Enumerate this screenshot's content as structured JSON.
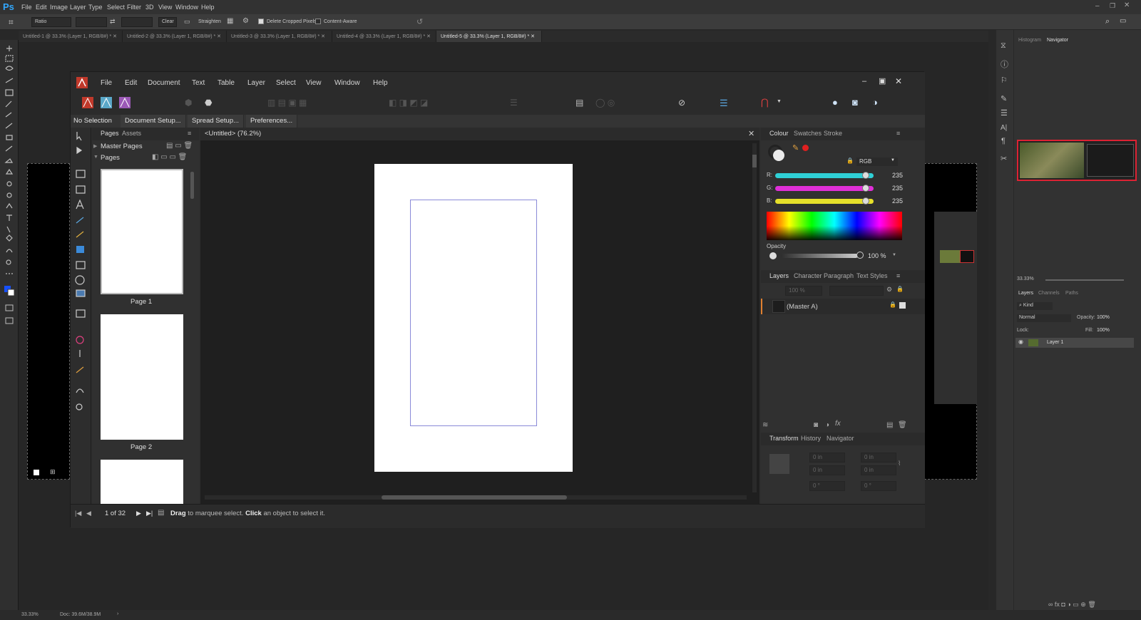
{
  "ps": {
    "logo": "Ps",
    "menu": [
      "File",
      "Edit",
      "Image",
      "Layer",
      "Type",
      "Select",
      "Filter",
      "3D",
      "View",
      "Window",
      "Help"
    ],
    "options": {
      "ratio": "Ratio",
      "clear": "Clear",
      "straighten": "Straighten",
      "delete_cropped": "Delete Cropped Pixels",
      "content_aware": "Content-Aware"
    },
    "tabs": [
      "Untitled-1 @ 33.3% (Layer 1, RGB/8#) *",
      "Untitled-2 @ 33.3% (Layer 1, RGB/8#) *",
      "Untitled-3 @ 33.3% (Layer 1, RGB/8#) *",
      "Untitled-4 @ 33.3% (Layer 1, RGB/8#) *",
      "Untitled-5 @ 33.3% (Layer 1, RGB/8#) *"
    ],
    "status_zoom": "33.33%",
    "status_doc": "Doc: 39.6M/38.9M",
    "panel": {
      "top_tabs": [
        "Histogram",
        "Navigator"
      ],
      "nav_zoom": "33.33%",
      "layer_tabs": [
        "Layers",
        "Channels",
        "Paths"
      ],
      "kind": "Kind",
      "blend": "Normal",
      "opacity_label": "Opacity:",
      "opacity_val": "100%",
      "lock_label": "Lock:",
      "fill_label": "Fill:",
      "fill_val": "100%",
      "layer_name": "Layer 1"
    }
  },
  "af": {
    "menu": [
      "File",
      "Edit",
      "Document",
      "Text",
      "Table",
      "Layer",
      "Select",
      "View",
      "Window",
      "Help"
    ],
    "context": {
      "selection": "No Selection",
      "buttons": [
        "Document Setup...",
        "Spread Setup...",
        "Preferences..."
      ]
    },
    "pages_panel": {
      "tabs": [
        "Pages",
        "Assets"
      ],
      "master_pages": "Master Pages",
      "pages": "Pages",
      "thumbs": [
        "Page 1",
        "Page 2"
      ]
    },
    "doc_tab": "<Untitled> (76.2%)",
    "colour": {
      "tabs": [
        "Colour",
        "Swatches",
        "Stroke"
      ],
      "model": "RGB",
      "channels": [
        {
          "label": "R:",
          "value": "235",
          "color": "#2fd0d6"
        },
        {
          "label": "G:",
          "value": "235",
          "color": "#e02fd8"
        },
        {
          "label": "B:",
          "value": "235",
          "color": "#e6e02a"
        }
      ],
      "opacity_label": "Opacity",
      "opacity_value": "100 %"
    },
    "layers": {
      "tabs": [
        "Layers",
        "Character",
        "Paragraph",
        "Text Styles"
      ],
      "opacity": "100 %",
      "item": "(Master A)"
    },
    "transform": {
      "tabs": [
        "Transform",
        "History",
        "Navigator"
      ],
      "x": "0 in",
      "y": "0 in",
      "w": "0 in",
      "h": "0 in",
      "r": "0 °",
      "s": "0 °"
    },
    "status": {
      "page_of": "1 of 32",
      "hint_drag": "Drag",
      "hint_mid": " to marquee select. ",
      "hint_click": "Click",
      "hint_end": " an object to select it."
    }
  }
}
